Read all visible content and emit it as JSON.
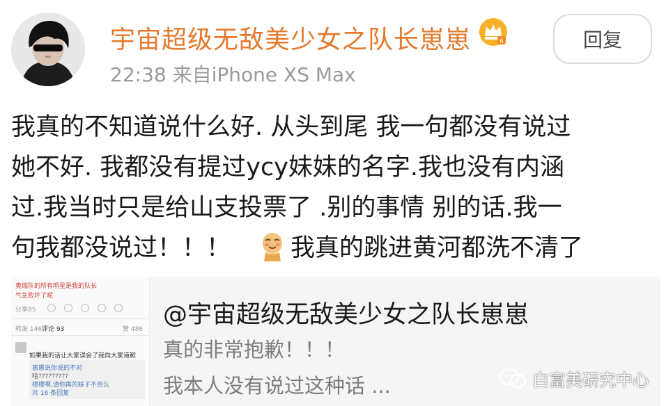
{
  "post": {
    "username": "宇宙超级无敌美少女之队长崽崽",
    "meta": "22:38  来自iPhone XS Max",
    "reply_label": "回复",
    "content_lines": [
      "我真的不知道说什么好. 从头到尾 我一句都没有说过",
      "她不好. 我都没有提过ycy妹妹的名字.我也没有内涵",
      "过.我当时只是给山支投票了 .别的事情 别的话.我一"
    ],
    "content_last_before": "句我都没说过！！！",
    "content_last_after": "我真的跳进黄河都洗不清了"
  },
  "quote": {
    "title": "@宇宙超级无敌美少女之队长崽崽",
    "line1": "真的非常抱歉！！！",
    "line2": "我本人没有说过这种话 ...",
    "thumb": {
      "text1": "奥瑞队的所有明星是我的队长",
      "text2": "气急败坏了呢",
      "share": "分享85",
      "tab_forward": "转发 146",
      "tab_comment": "评论 93",
      "tab_like": "赞 486",
      "c1": "如果我的话让大家误会了我向大家道歉",
      "c2": "崽崽说你说的不对",
      "c3": "哈?????????",
      "c4": "楼楼啊,请你再的妹子不否么",
      "c5": "共 16 条回复"
    }
  },
  "watermark": {
    "text": "白富美研究中心"
  },
  "colors": {
    "username": "#e5792c",
    "meta": "#9a9a9a",
    "quote_bg": "#f5f5f5"
  }
}
